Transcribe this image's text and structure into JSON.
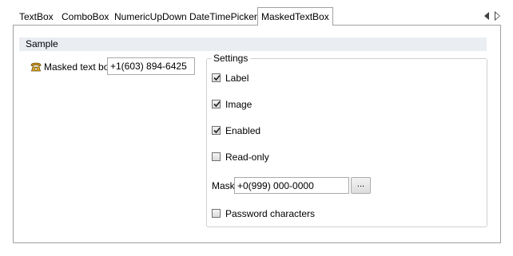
{
  "tabs": {
    "textbox": "TextBox",
    "combobox": "ComboBox",
    "numeric": "NumericUpDown",
    "datetime": "DateTimePicker",
    "masked": "MaskedTextBox"
  },
  "sample": {
    "header": "Sample",
    "label": "Masked text box",
    "value": "+1(603) 894-6425",
    "icon": "phone-icon"
  },
  "settings": {
    "title": "Settings",
    "label": {
      "text": "Label",
      "checked": true
    },
    "image": {
      "text": "Image",
      "checked": true
    },
    "enabled": {
      "text": "Enabled",
      "checked": true
    },
    "readonly": {
      "text": "Read-only",
      "checked": false
    },
    "mask_label": "Mask",
    "mask_value": "+0(999) 000-0000",
    "mask_button": "...",
    "password": {
      "text": "Password characters",
      "checked": false
    }
  },
  "colors": {
    "header_bg": "#eaedf2",
    "border": "#a0a0a0"
  }
}
